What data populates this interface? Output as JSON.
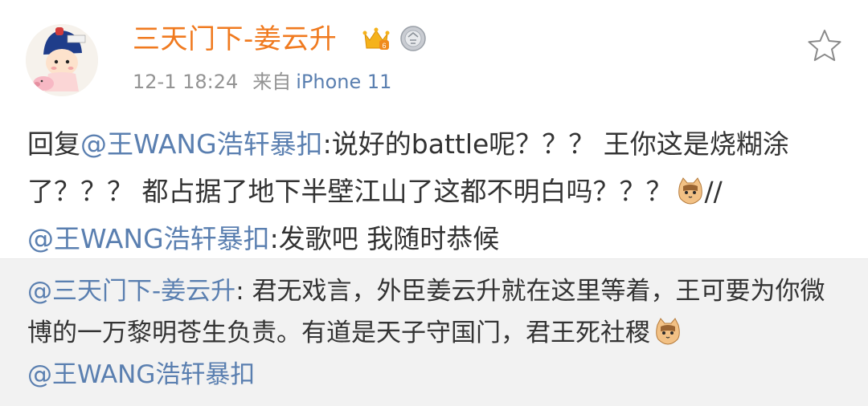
{
  "post": {
    "user_name": "三天门下-姜云升",
    "timestamp": "12-1 18:24",
    "source_prefix": "来自",
    "source_device": "iPhone 11",
    "badge_icons": [
      "crown-badge-icon",
      "medal-badge-icon"
    ],
    "avatar_icon": "cartoon-avatar"
  },
  "reply": {
    "prefix": "回复",
    "mention1": "@王WANG浩轩暴扣",
    "text1": ":说好的battle呢？？？ 王你这是烧糊涂了？？？ 都占据了地下半壁江山了这都不明白吗？？？",
    "separator": "//",
    "mention2": "@王WANG浩轩暴扣",
    "text2": ":发歌吧 我随时恭候"
  },
  "quoted": {
    "mention_author": "@三天门下-姜云升",
    "text": ": 君无戏言，外臣姜云升就在这里等着，王可要为你微博的一万黎明苍生负责。有道是天子守国门，君王死社稷",
    "mention_end": "@王WANG浩轩暴扣"
  },
  "colors": {
    "name_orange": "#f07a1f",
    "link_blue": "#5a7fb0",
    "meta_gray": "#939393",
    "quote_bg": "#f2f2f2"
  }
}
